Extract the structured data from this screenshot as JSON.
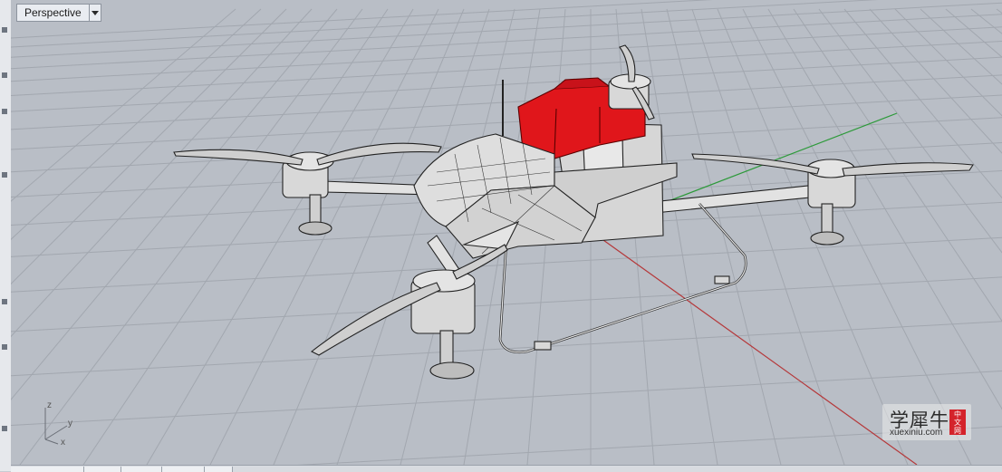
{
  "viewport": {
    "title": "Perspective",
    "grid_color": "#9ea3ab",
    "background": "#b9bec6",
    "x_axis_color": "#b5383a",
    "y_axis_color": "#2d9a3a",
    "highlight_color": "#e0161b"
  },
  "axis_widget": {
    "z": "z",
    "y": "y",
    "x": "x"
  },
  "watermark": {
    "text": "学犀牛",
    "site": "xuexiniu.com",
    "badge": [
      "中",
      "文",
      "网"
    ]
  },
  "icons": {
    "dropdown": "chevron-down-icon"
  }
}
